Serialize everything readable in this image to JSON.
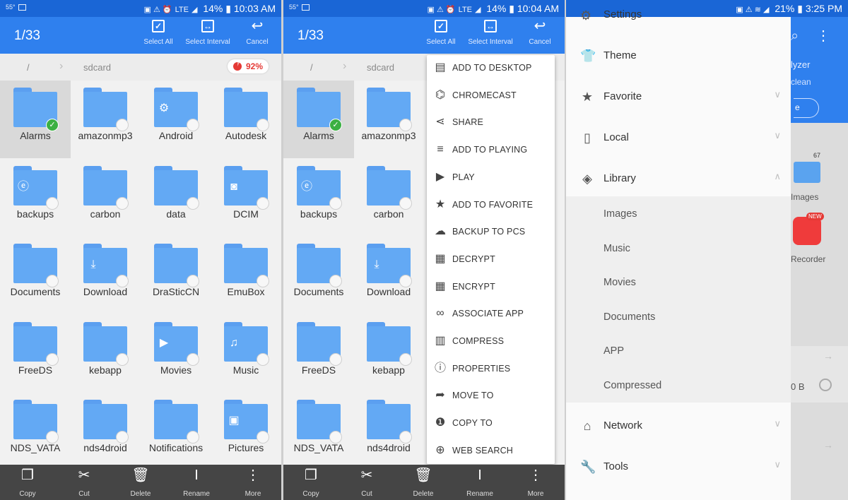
{
  "status": {
    "left_temp": "55°",
    "panel1_right": "14%",
    "panel1_time": "10:03 AM",
    "panel2_time": "10:04 AM",
    "panel3_right": "21%",
    "panel3_time": "3:25 PM",
    "lte": "LTE"
  },
  "actionbar": {
    "count": "1/33",
    "select_all": "Select All",
    "select_interval": "Select Interval",
    "cancel": "Cancel"
  },
  "breadcrumb": {
    "root": "/",
    "folder": "sdcard",
    "storage": "92%"
  },
  "folders": [
    {
      "name": "Alarms",
      "selected": true
    },
    {
      "name": "amazonmp3"
    },
    {
      "name": "Android",
      "badge": "gear-icon"
    },
    {
      "name": "Autodesk"
    },
    {
      "name": "backups",
      "badge": "es-icon"
    },
    {
      "name": "carbon"
    },
    {
      "name": "data"
    },
    {
      "name": "DCIM",
      "badge": "camera-icon"
    },
    {
      "name": "Documents"
    },
    {
      "name": "Download",
      "badge": "download-icon"
    },
    {
      "name": "DraSticCN"
    },
    {
      "name": "EmuBox"
    },
    {
      "name": "FreeDS"
    },
    {
      "name": "kebapp"
    },
    {
      "name": "Movies",
      "badge": "play-icon"
    },
    {
      "name": "Music",
      "badge": "music-note-icon"
    },
    {
      "name": "NDS_VATA"
    },
    {
      "name": "nds4droid"
    },
    {
      "name": "Notifications"
    },
    {
      "name": "Pictures",
      "badge": "image-icon"
    }
  ],
  "bottom_toolbar": {
    "copy": "Copy",
    "cut": "Cut",
    "delete": "Delete",
    "rename": "Rename",
    "more": "More"
  },
  "context_menu": [
    {
      "label": "ADD TO DESKTOP",
      "icon": "add-to-desktop-icon"
    },
    {
      "label": "CHROMECAST",
      "icon": "chromecast-icon"
    },
    {
      "label": "SHARE",
      "icon": "share-icon"
    },
    {
      "label": "ADD TO PLAYING",
      "icon": "playlist-add-icon"
    },
    {
      "label": "PLAY",
      "icon": "play-icon"
    },
    {
      "label": "ADD TO FAVORITE",
      "icon": "star-icon"
    },
    {
      "label": "BACKUP TO PCS",
      "icon": "cloud-upload-icon"
    },
    {
      "label": "DECRYPT",
      "icon": "decrypt-icon"
    },
    {
      "label": "ENCRYPT",
      "icon": "encrypt-icon"
    },
    {
      "label": "ASSOCIATE APP",
      "icon": "link-icon"
    },
    {
      "label": "COMPRESS",
      "icon": "compress-icon"
    },
    {
      "label": "PROPERTIES",
      "icon": "info-icon"
    },
    {
      "label": "MOVE TO",
      "icon": "move-arrow-icon"
    },
    {
      "label": "COPY TO",
      "icon": "copy-to-icon"
    },
    {
      "label": "WEB SEARCH",
      "icon": "web-search-icon"
    }
  ],
  "drawer": {
    "partial_top": "Settings",
    "items": [
      {
        "label": "Theme",
        "icon": "shirt-icon"
      },
      {
        "label": "Favorite",
        "icon": "star-icon",
        "chevron": "down"
      },
      {
        "label": "Local",
        "icon": "phone-icon",
        "chevron": "down"
      },
      {
        "label": "Library",
        "icon": "layers-icon",
        "chevron": "up"
      }
    ],
    "library_sub": [
      "Images",
      "Music",
      "Movies",
      "Documents",
      "APP",
      "Compressed"
    ],
    "bottom_items": [
      {
        "label": "Network",
        "icon": "router-icon",
        "chevron": "down"
      },
      {
        "label": "Tools",
        "icon": "wrench-icon",
        "chevron": "down"
      }
    ]
  },
  "background_app": {
    "analyzer_partial": "lyzer",
    "clean_partial": "clean",
    "e_partial": "e",
    "images_label": "Images",
    "images_count": "67",
    "recorder_label": "Recorder",
    "new_badge": "NEW",
    "size_partial": "0 B"
  }
}
